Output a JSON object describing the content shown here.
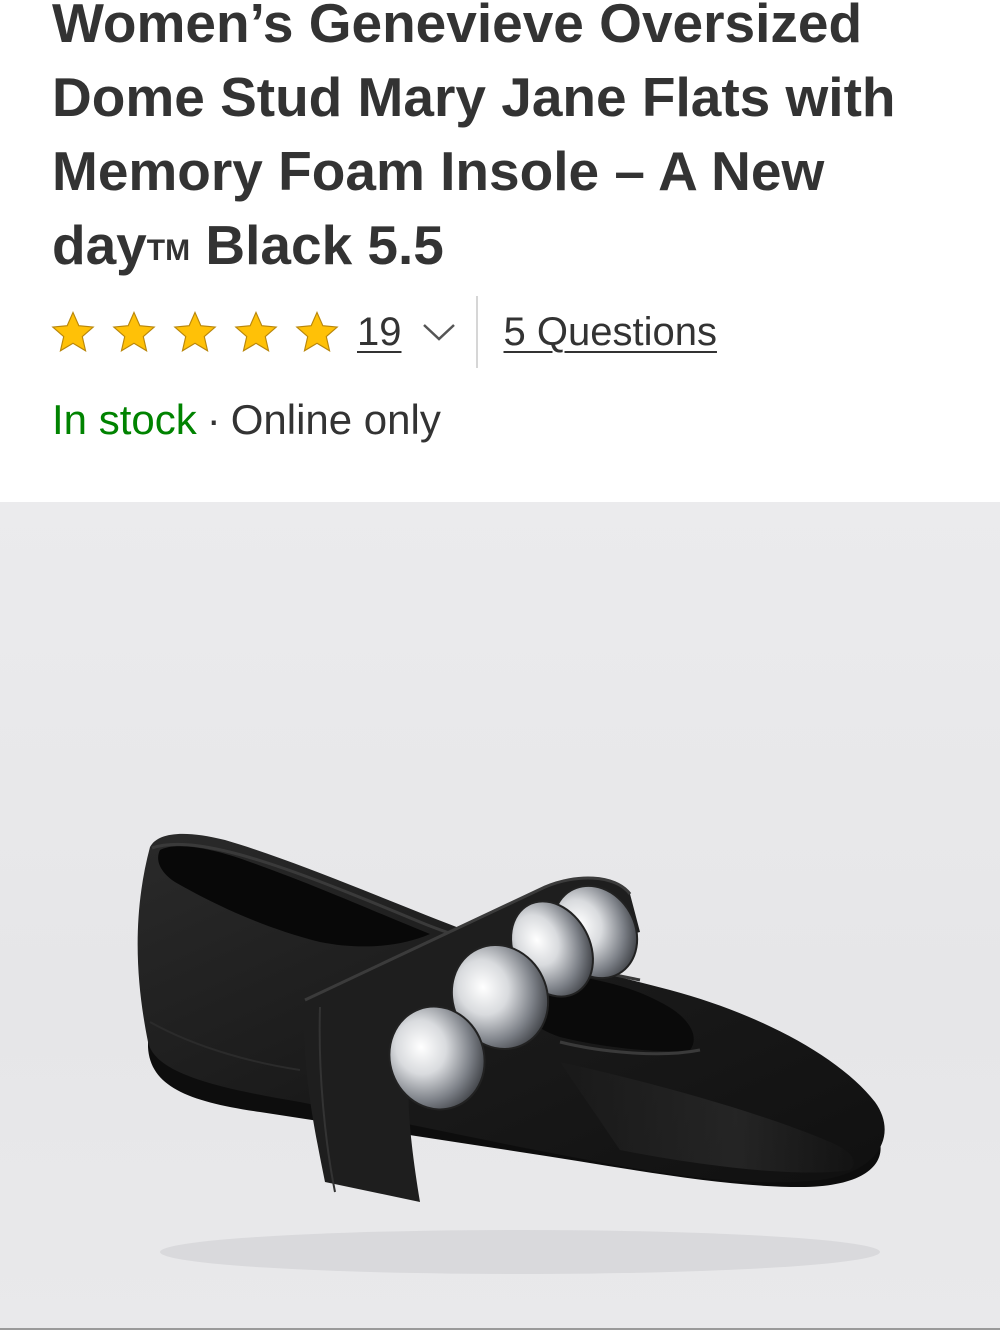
{
  "product": {
    "title_main": "Women’s Genevieve Oversized Dome Stud Mary Jane Flats with Memory Foam Insole – A New day",
    "title_tm": "TM",
    "title_tail": " Black 5.5"
  },
  "rating": {
    "stars_filled": 5,
    "stars_total": 5,
    "review_count": "19",
    "questions_label": "5 Questions",
    "star_color": "#ffc107"
  },
  "availability": {
    "status": "In stock",
    "separator": "·",
    "channel": "Online only",
    "status_color": "#008300"
  },
  "image": {
    "subject": "black mary jane flat with silver dome studs"
  }
}
